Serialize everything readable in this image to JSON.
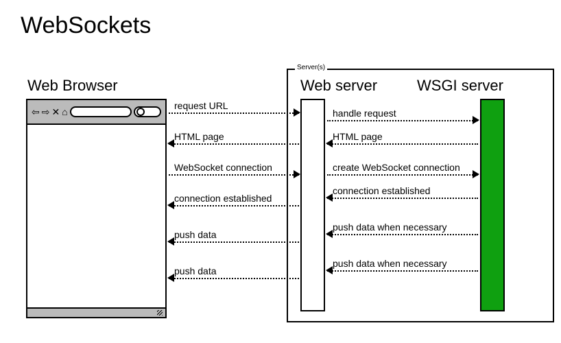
{
  "title": "WebSockets",
  "browser_label": "Web Browser",
  "servers_group_label": "Server(s)",
  "webserver_label": "Web server",
  "wsgi_label": "WSGI server",
  "left_arrows": [
    {
      "label": "request URL",
      "direction": "right"
    },
    {
      "label": "HTML page",
      "direction": "left"
    },
    {
      "label": "WebSocket connection",
      "direction": "right"
    },
    {
      "label": "connection established",
      "direction": "left"
    },
    {
      "label": "push data",
      "direction": "left"
    },
    {
      "label": "push data",
      "direction": "left"
    }
  ],
  "right_arrows": [
    {
      "label": "handle request",
      "direction": "right"
    },
    {
      "label": "HTML page",
      "direction": "left"
    },
    {
      "label": "create WebSocket connection",
      "direction": "right"
    },
    {
      "label": "connection established",
      "direction": "left"
    },
    {
      "label": "push data when necessary",
      "direction": "left"
    },
    {
      "label": "push data when necessary",
      "direction": "left"
    }
  ]
}
